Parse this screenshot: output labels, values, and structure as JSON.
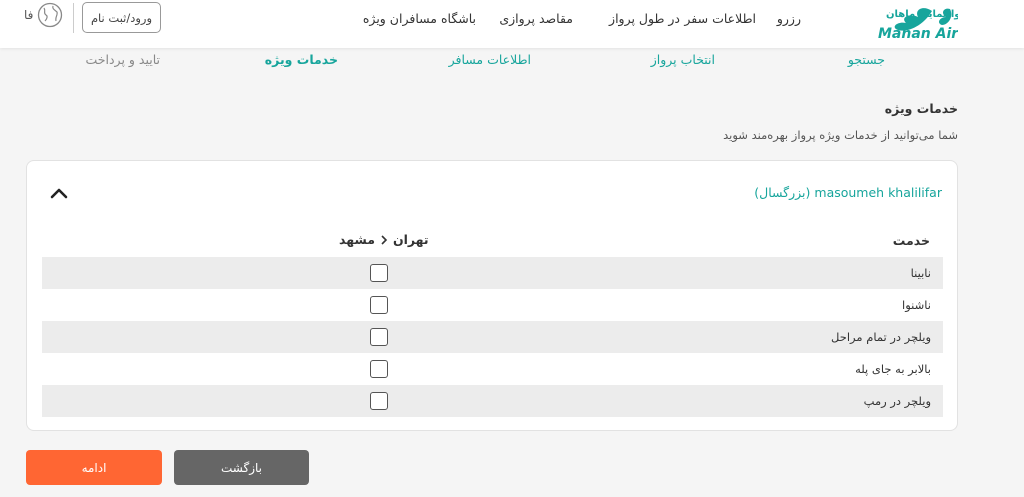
{
  "header": {
    "logo": {
      "text_fa": "هواپیمایی ماهان",
      "text_en": "Mahan Air",
      "color": "#17a59c"
    },
    "nav": [
      "رزرو",
      "اطلاعات سفر",
      "در طول پرواز",
      "مقاصد پروازی",
      "باشگاه مسافران ویژه"
    ],
    "login_label": "ورود/ثبت نام",
    "language": {
      "label": "فا",
      "icon": "globe-icon"
    }
  },
  "steps": [
    {
      "label": "جستجو",
      "state": "done"
    },
    {
      "label": "انتخاب پرواز",
      "state": "done"
    },
    {
      "label": "اطلاعات مسافر",
      "state": "done"
    },
    {
      "label": "خدمات ویژه",
      "state": "active"
    },
    {
      "label": "تایید و پرداخت",
      "state": "pending"
    }
  ],
  "section": {
    "title": "خدمات ویژه",
    "subtitle": "شما می‌توانید از خدمات ویژه پرواز بهره‌مند شوید"
  },
  "card": {
    "passenger_label": "masoumeh khalilifar (بزرگسال)",
    "collapse_icon": "chevron-up-icon",
    "column_service": "خدمت",
    "route": {
      "from": "تهران",
      "to": "مشهد",
      "icon": "chevron-right-icon"
    },
    "services": [
      {
        "label": "نابینا",
        "checked": false
      },
      {
        "label": "ناشنوا",
        "checked": false
      },
      {
        "label": "ویلچر در تمام مراحل",
        "checked": false
      },
      {
        "label": "بالابر به جای پله",
        "checked": false
      },
      {
        "label": "ویلچر در رمپ",
        "checked": false
      }
    ]
  },
  "buttons": {
    "continue": "ادامه",
    "back": "بازگشت"
  },
  "colors": {
    "accent": "#17a59c",
    "primary_button": "#ff6633",
    "secondary_button": "#666666",
    "row_shade": "#ececec"
  }
}
